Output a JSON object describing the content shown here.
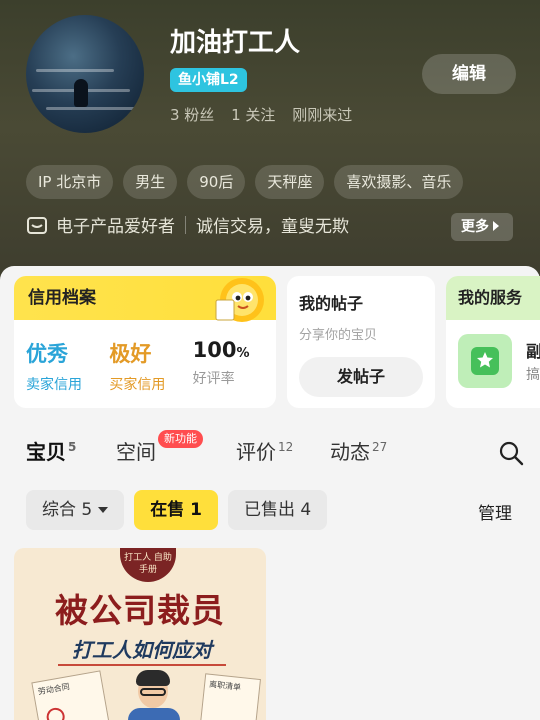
{
  "profile": {
    "username": "加油打工人",
    "level": "鱼小铺L2",
    "stats": [
      "3 粉丝",
      "1 关注",
      "刚刚来过"
    ],
    "edit_label": "编辑",
    "tags": [
      "IP 北京市",
      "男生",
      "90后",
      "天秤座",
      "喜欢摄影、音乐"
    ],
    "bio_role": "电子产品爱好者",
    "bio_text": "诚信交易，童叟无欺",
    "more_label": "更多"
  },
  "credit_card": {
    "title": "信用档案",
    "items": [
      {
        "value": "优秀",
        "label": "卖家信用"
      },
      {
        "value": "极好",
        "label": "买家信用"
      },
      {
        "value": "100",
        "unit": "%",
        "label": "好评率"
      }
    ]
  },
  "posts_card": {
    "title": "我的帖子",
    "subtitle": "分享你的宝贝",
    "button": "发帖子"
  },
  "service_card": {
    "title": "我的服务",
    "line1": "副",
    "line2": "搞"
  },
  "tabs": [
    {
      "label": "宝贝",
      "count": "5"
    },
    {
      "label": "空间",
      "badge": "新功能"
    },
    {
      "label": "评价",
      "count": "12"
    },
    {
      "label": "动态",
      "count": "27"
    }
  ],
  "filters": {
    "chips": [
      "综合 5",
      "在售 1",
      "已售出 4"
    ],
    "manage": "管理"
  },
  "product": {
    "seal": "打工人 自助手册",
    "title": "被公司裁员",
    "subtitle": "打工人如何应对",
    "left_doc": "劳动合同",
    "right_doc": "离职清单"
  },
  "colors": {
    "accent_yellow": "#ffdf3b",
    "level_blue": "#2ec4e0",
    "seller_blue": "#2aa4d8",
    "buyer_orange": "#e39a26"
  }
}
